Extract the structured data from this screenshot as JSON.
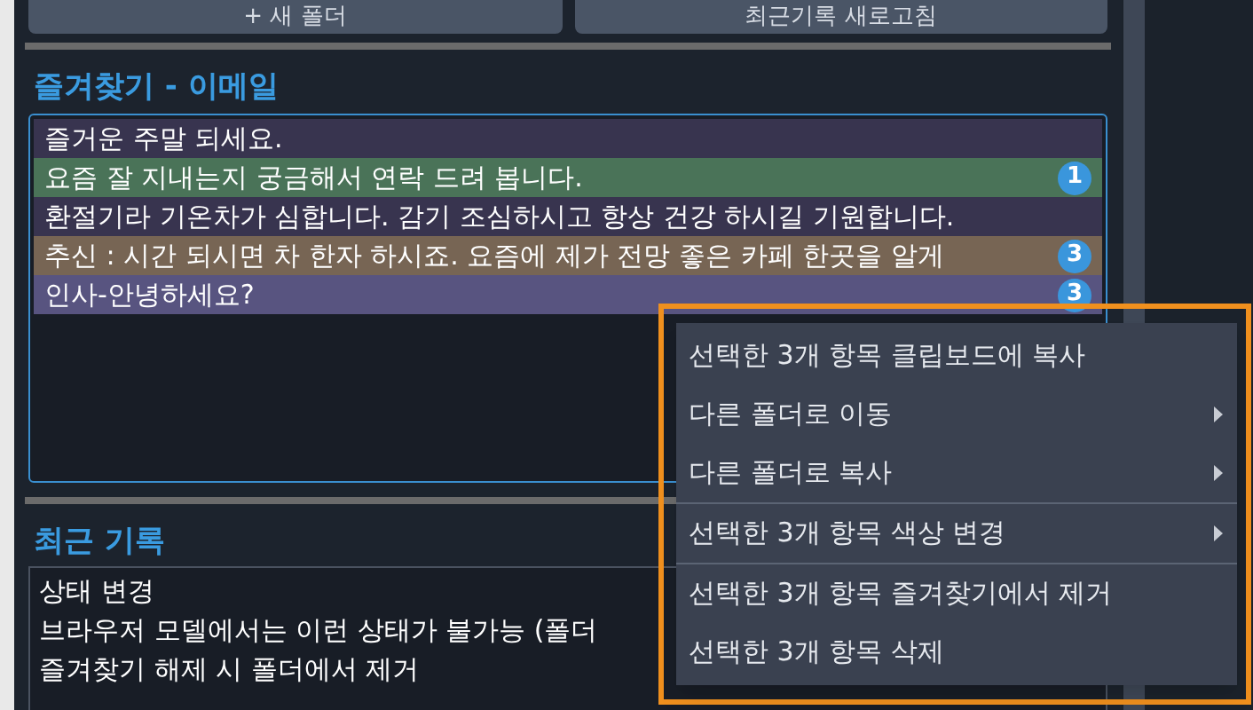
{
  "buttons": [
    "+ 새 폴더",
    "최근기록 새로고침"
  ],
  "favorites": {
    "title": "즐겨찾기 - 이메일",
    "items": [
      {
        "text": "즐거운 주말 되세요.",
        "color": "#38344f"
      },
      {
        "text": "요즘 잘 지내는지 궁금해서 연락 드려 봅니다.",
        "color": "#4a7358",
        "badge": "1"
      },
      {
        "text": "환절기라 기온차가 심합니다. 감기 조심하시고 항상 건강 하시길 기원합니다.",
        "color": "#38344f"
      },
      {
        "text": "추신 : 시간 되시면 차 한자 하시죠. 요즘에 제가 전망 좋은 카페 한곳을 알게",
        "color": "#776554",
        "badge": "3"
      },
      {
        "text": "인사-안녕하세요?",
        "color": "#585480",
        "badge": "3"
      }
    ]
  },
  "recent": {
    "title": "최근 기록",
    "lines": [
      "상태 변경",
      "브라우저 모델에서는 이런 상태가 불가능 (폴더",
      "즐겨찾기 해제 시 폴더에서 제거"
    ]
  },
  "context_menu": {
    "items": [
      {
        "label": "선택한 3개 항목 클립보드에 복사",
        "submenu": false,
        "separator_after": false
      },
      {
        "label": "다른 폴더로 이동",
        "submenu": true,
        "separator_after": false
      },
      {
        "label": "다른 폴더로 복사",
        "submenu": true,
        "separator_after": true
      },
      {
        "label": "선택한 3개 항목 색상 변경",
        "submenu": true,
        "separator_after": true
      },
      {
        "label": "선택한 3개 항목 즐겨찾기에서 제거",
        "submenu": false,
        "separator_after": false
      },
      {
        "label": "선택한 3개 항목 삭제",
        "submenu": false,
        "separator_after": false
      }
    ]
  }
}
